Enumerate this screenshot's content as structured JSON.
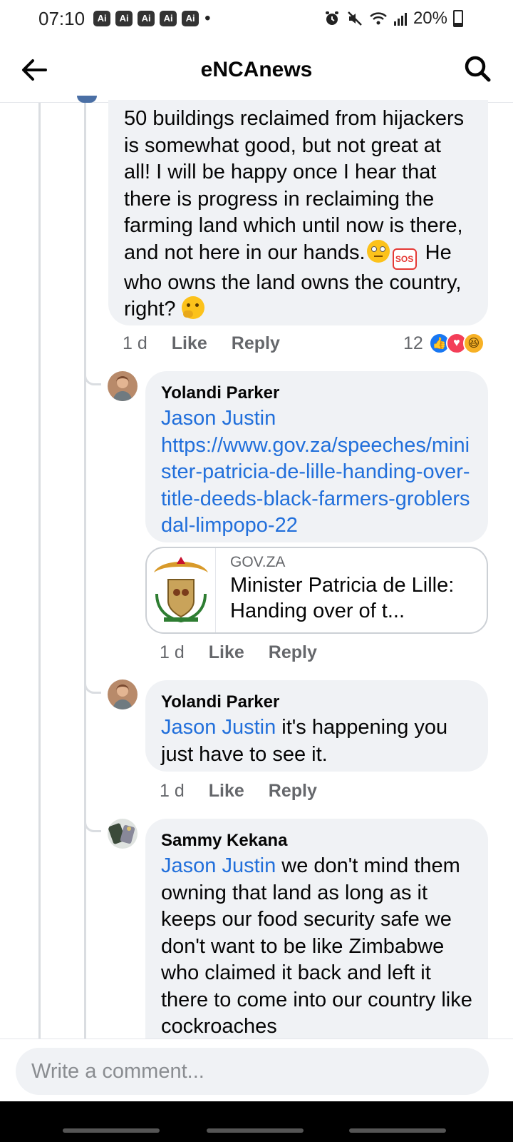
{
  "status_bar": {
    "time": "07:10",
    "ai_badges": [
      "Ai",
      "Ai",
      "Ai",
      "Ai",
      "Ai"
    ],
    "dot": "•",
    "battery": "20%",
    "battery_level": 0.2
  },
  "header": {
    "title": "eNCAnews"
  },
  "comments": [
    {
      "text": "50 buildings reclaimed from hijackers is somewhat good, but not great at all! I will be happy once I hear that there is progress in reclaiming the farming land which until now is there, and not here in our hands.",
      "emoji_1": "rolling-eyes-emoji",
      "sos": "SOS",
      "text_2": " He who owns the land owns the country, right?",
      "emoji_2": "thinking-face-emoji",
      "time": "1 d",
      "like": "Like",
      "reply": "Reply",
      "reaction_count": "12"
    },
    {
      "author": "Yolandi Parker",
      "mention": "Jason Justin",
      "link": "https://www.gov.za/speeches/minister-patricia-de-lille-handing-over-title-deeds-black-farmers-groblersdal-limpopo-22",
      "preview_domain": "GOV.ZA",
      "preview_title": "Minister Patricia de Lille: Handing over of t...",
      "time": "1 d",
      "like": "Like",
      "reply": "Reply"
    },
    {
      "author": "Yolandi Parker",
      "mention": "Jason Justin",
      "text": " it's happening you just have to see it.",
      "time": "1 d",
      "like": "Like",
      "reply": "Reply"
    },
    {
      "author": "Sammy Kekana",
      "mention": "Jason Justin",
      "text": " we don't mind them owning that land as long as it keeps our food security safe we don't want to be like Zimbabwe who claimed it back and left it there to come into our country like cockroaches"
    }
  ],
  "composer": {
    "placeholder": "Write a comment..."
  },
  "colors": {
    "link": "#216fdb",
    "bubble": "#f0f2f5",
    "like_blue": "#1877f2",
    "love_red": "#f33e58",
    "haha_yellow": "#f7b125"
  }
}
